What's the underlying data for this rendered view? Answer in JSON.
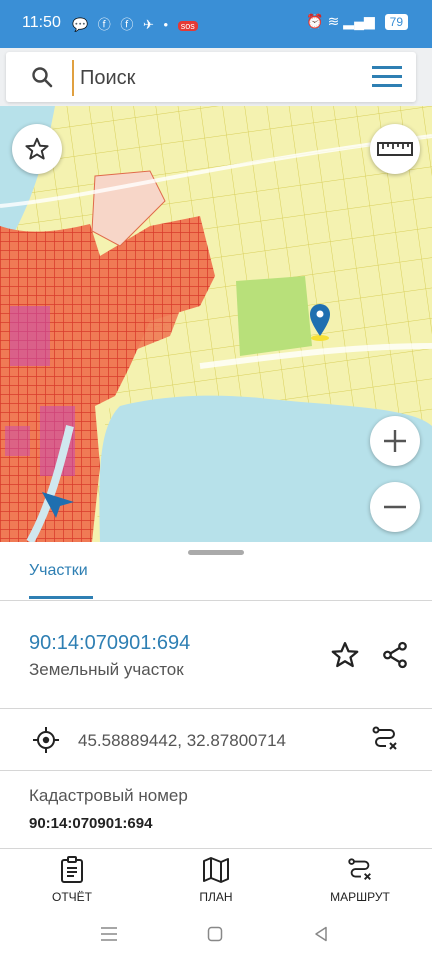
{
  "status_bar": {
    "time": "11:50",
    "notification_icons": "💬 ⓕ ⓕ ✈ • ",
    "sos_badge": "sos",
    "battery": "79"
  },
  "search": {
    "placeholder": "Поиск"
  },
  "bottom_sheet": {
    "tab_label": "Участки",
    "parcel": {
      "number": "90:14:070901:694",
      "type": "Земельный участок"
    },
    "coordinates": "45.58889442, 32.87800714",
    "field_label": "Кадастровый номер",
    "field_value": "90:14:070901:694"
  },
  "bottom_nav": {
    "report_label": "ОТЧЁТ",
    "plan_label": "ПЛАН",
    "route_label": "МАРШРУТ"
  },
  "colors": {
    "accent": "#2e7fb3",
    "status_bar": "#3a8fd6",
    "water": "#b7e1ea",
    "land": "#f2f0a5",
    "urban": "#e8593a"
  }
}
